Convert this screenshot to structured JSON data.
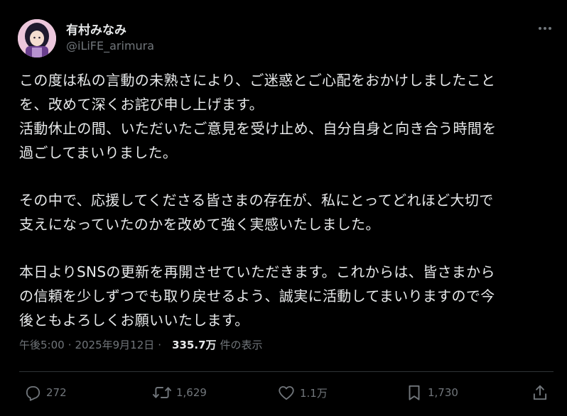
{
  "author": {
    "display_name": "有村みなみ",
    "handle": "@iLiFE_arimura"
  },
  "tweet": {
    "lines": [
      "この度は私の言動の未熟さにより、ご迷惑とご心配をおかけしましたこと",
      "を、改めて深くお詫び申し上げます。",
      "活動休止の間、いただいたご意見を受け止め、自分自身と向き合う時間を",
      "過ごしてまいりました。",
      "",
      "その中で、応援してくださる皆さまの存在が、私にとってどれほど大切で",
      "支えになっていたのかを改めて強く実感いたしました。",
      "",
      "本日よりSNSの更新を再開させていただきます。これからは、皆さまから",
      "の信頼を少しずつでも取り戻せるよう、誠実に活動してまいりますので今",
      "後ともよろしくお願いいたします。"
    ]
  },
  "meta": {
    "time": "午後5:00",
    "separator": "·",
    "date": "2025年9月12日",
    "views_count": "335.7万",
    "views_label": "件の表示"
  },
  "actions": {
    "replies": "272",
    "reposts": "1,629",
    "likes": "1.1万",
    "bookmarks": "1,730"
  },
  "icons": {
    "more": "more-horizontal-icon",
    "reply": "reply-icon",
    "repost": "repost-icon",
    "like": "heart-icon",
    "bookmark": "bookmark-icon",
    "share": "share-icon"
  },
  "colors": {
    "background": "#000000",
    "text_primary": "#e7e9ea",
    "text_secondary": "#71767b",
    "divider": "#2f3336"
  }
}
